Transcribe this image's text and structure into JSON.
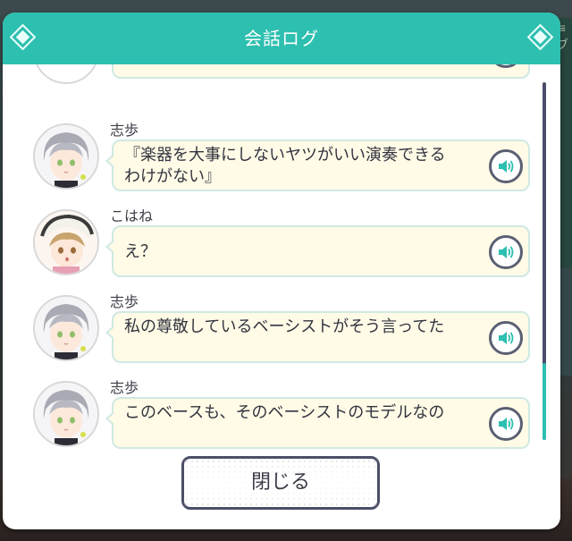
{
  "dialog": {
    "title": "会話ログ",
    "close_label": "閉じる"
  },
  "log": {
    "entries": [
      {
        "speaker": "志歩",
        "text": "『楽器を大事にしないヤツがいい演奏できる\nわけがない』",
        "character": "shiho"
      },
      {
        "speaker": "こはね",
        "text": "え？",
        "character": "kohane"
      },
      {
        "speaker": "志歩",
        "text": "私の尊敬しているベーシストがそう言ってた",
        "character": "shiho"
      },
      {
        "speaker": "志歩",
        "text": "このベースも、そのベーシストのモデルなの",
        "character": "shiho"
      }
    ]
  },
  "icons": {
    "voice": "speaker-icon",
    "decoration": "diamond-icon"
  },
  "colors": {
    "header": "#2dbfb0",
    "bubble_fill": "#fffbe6",
    "bubble_border": "#cfe9e3",
    "button_border": "#4b4f68",
    "scroll_thumb": "#2dbfb0"
  }
}
